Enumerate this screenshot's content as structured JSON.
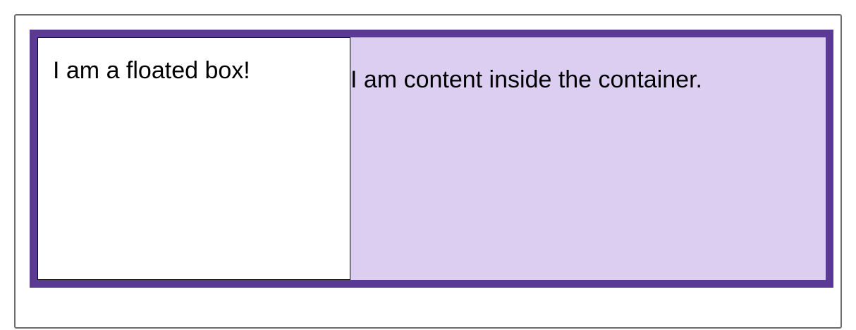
{
  "floated_box": {
    "text": "I am a floated box!"
  },
  "container": {
    "text": "I am content inside the container."
  },
  "colors": {
    "container_border": "#5b3a95",
    "container_background": "#dbcef1",
    "floated_box_background": "#ffffff"
  }
}
